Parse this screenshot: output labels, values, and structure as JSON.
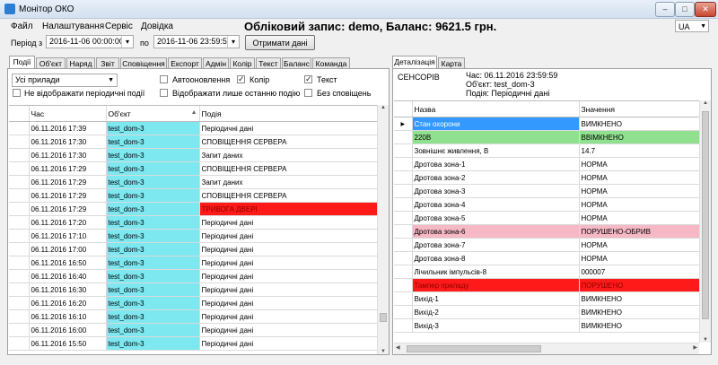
{
  "window": {
    "title": "Монітор ОКО",
    "controls": [
      "–",
      "□",
      "✕"
    ]
  },
  "menu": [
    "Файл",
    "Налаштування",
    "Сервіс",
    "Довідка"
  ],
  "header": {
    "account_text": "Обліковий запис: demo, Баланс: 9621.5 грн.",
    "language": "UA"
  },
  "period": {
    "label_from": "Період з",
    "from": "2016-11-06 00:00:00",
    "label_to": "по",
    "to": "2016-11-06 23:59:59",
    "button": "Отримати дані"
  },
  "tabs": [
    "Події",
    "Об'єкт",
    "Наряд",
    "Звіт",
    "Сповіщення",
    "Експорт",
    "Адмін",
    "Колір",
    "Текст",
    "Баланс",
    "Команда"
  ],
  "filters": {
    "device_select": "Усі прилади",
    "no_periodic": "Не відображати періодичні події",
    "auto_update": "Автооновлення",
    "last_event_only": "Відображати лише останню подію",
    "color": "Колір",
    "text": "Текст",
    "no_notifications": "Без сповіщень"
  },
  "events_table": {
    "columns": [
      "Час",
      "Об'єкт",
      "Подія"
    ],
    "rows": [
      {
        "time": "06.11.2016 17:39",
        "object": "test_dom-3",
        "event": "Періодичні дані",
        "type": "normal"
      },
      {
        "time": "06.11.2016 17:30",
        "object": "test_dom-3",
        "event": "СПОВІЩЕННЯ СЕРВЕРА",
        "type": "normal"
      },
      {
        "time": "06.11.2016 17:30",
        "object": "test_dom-3",
        "event": "Запит даних",
        "type": "normal"
      },
      {
        "time": "06.11.2016 17:29",
        "object": "test_dom-3",
        "event": "СПОВІЩЕННЯ СЕРВЕРА",
        "type": "normal"
      },
      {
        "time": "06.11.2016 17:29",
        "object": "test_dom-3",
        "event": "Запит даних",
        "type": "normal"
      },
      {
        "time": "06.11.2016 17:29",
        "object": "test_dom-3",
        "event": "СПОВІЩЕННЯ СЕРВЕРА",
        "type": "normal"
      },
      {
        "time": "06.11.2016 17:29",
        "object": "test_dom-3",
        "event": "ТРИВОГА ДВЕРІ",
        "type": "alarm"
      },
      {
        "time": "06.11.2016 17:20",
        "object": "test_dom-3",
        "event": "Періодичні дані",
        "type": "normal"
      },
      {
        "time": "06.11.2016 17:10",
        "object": "test_dom-3",
        "event": "Періодичні дані",
        "type": "normal"
      },
      {
        "time": "06.11.2016 17:00",
        "object": "test_dom-3",
        "event": "Періодичні дані",
        "type": "normal"
      },
      {
        "time": "06.11.2016 16:50",
        "object": "test_dom-3",
        "event": "Періодичні дані",
        "type": "normal"
      },
      {
        "time": "06.11.2016 16:40",
        "object": "test_dom-3",
        "event": "Періодичні дані",
        "type": "normal"
      },
      {
        "time": "06.11.2016 16:30",
        "object": "test_dom-3",
        "event": "Періодичні дані",
        "type": "normal"
      },
      {
        "time": "06.11.2016 16:20",
        "object": "test_dom-3",
        "event": "Періодичні дані",
        "type": "normal"
      },
      {
        "time": "06.11.2016 16:10",
        "object": "test_dom-3",
        "event": "Періодичні дані",
        "type": "normal"
      },
      {
        "time": "06.11.2016 16:00",
        "object": "test_dom-3",
        "event": "Періодичні дані",
        "type": "normal"
      },
      {
        "time": "06.11.2016 15:50",
        "object": "test_dom-3",
        "event": "Періодичні дані",
        "type": "normal"
      }
    ]
  },
  "detail_tabs": [
    "Деталізація",
    "Карта"
  ],
  "detail_info": {
    "section": "СЕНСОРІВ",
    "lines": [
      "Час: 06.11.2016 23:59:59",
      "Об'єкт: test_dom-3",
      "Подія: Періодичні дані"
    ]
  },
  "sensors_table": {
    "columns": [
      "Назва",
      "Значення"
    ],
    "rows": [
      {
        "name": "Стан охорони",
        "value": "ВИМКНЕНО",
        "style": "selected"
      },
      {
        "name": "220В",
        "value": "ВВІМКНЕНО",
        "style": "ok"
      },
      {
        "name": "Зовнішнє живлення, В",
        "value": "14.7",
        "style": "normal"
      },
      {
        "name": "Дротова зона-1",
        "value": "НОРМА",
        "style": "normal"
      },
      {
        "name": "Дротова зона-2",
        "value": "НОРМА",
        "style": "normal"
      },
      {
        "name": "Дротова зона-3",
        "value": "НОРМА",
        "style": "normal"
      },
      {
        "name": "Дротова зона-4",
        "value": "НОРМА",
        "style": "normal"
      },
      {
        "name": "Дротова зона-5",
        "value": "НОРМА",
        "style": "normal"
      },
      {
        "name": "Дротова зона-6",
        "value": "ПОРУШЕНО-ОБРИВ",
        "style": "warn"
      },
      {
        "name": "Дротова зона-7",
        "value": "НОРМА",
        "style": "normal"
      },
      {
        "name": "Дротова зона-8",
        "value": "НОРМА",
        "style": "normal"
      },
      {
        "name": "Лічильник імпульсів-8",
        "value": "000007",
        "style": "normal"
      },
      {
        "name": "Тампер приладу",
        "value": "ПОРУШЕНО",
        "style": "alarm"
      },
      {
        "name": "Вихід-1",
        "value": "ВИМКНЕНО",
        "style": "normal"
      },
      {
        "name": "Вихід-2",
        "value": "ВИМКНЕНО",
        "style": "normal"
      },
      {
        "name": "Вихід-3",
        "value": "ВИМКНЕНО",
        "style": "normal"
      }
    ]
  },
  "colors": {
    "object_cell": "#7de8f0",
    "alarm": "#ff1a1a",
    "ok": "#8fe08f",
    "warn": "#f5b8c4",
    "selected": "#3399ff"
  }
}
